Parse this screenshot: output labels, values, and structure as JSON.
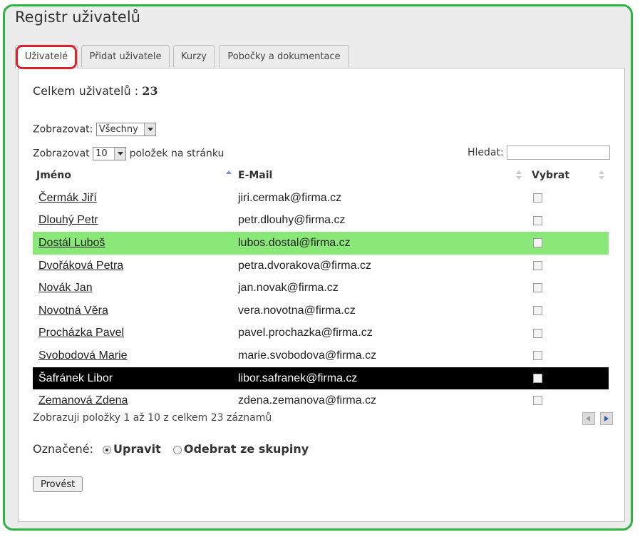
{
  "page": {
    "title": "Registr uživatelů"
  },
  "tabs": [
    {
      "label": "Uživatelé",
      "active": true
    },
    {
      "label": "Přidat uživatele"
    },
    {
      "label": "Kurzy"
    },
    {
      "label": "Pobočky a dokumentace"
    }
  ],
  "summary": {
    "label": "Celkem uživatelů :",
    "count": "23"
  },
  "filter": {
    "label": "Zobrazovat:",
    "selected": "Všechny"
  },
  "perpage": {
    "prefix": "Zobrazovat",
    "selected": "10",
    "suffix": "položek na stránku"
  },
  "search": {
    "label": "Hledat:",
    "value": ""
  },
  "table": {
    "headers": {
      "name": "Jméno",
      "email": "E-Mail",
      "select": "Vybrat"
    },
    "rows": [
      {
        "name": "Čermák Jiří",
        "email": "jiri.cermak@firma.cz"
      },
      {
        "name": "Dlouhý Petr",
        "email": "petr.dlouhy@firma.cz"
      },
      {
        "name": "Dostál Luboš",
        "email": "lubos.dostal@firma.cz",
        "highlight": "green"
      },
      {
        "name": "Dvořáková Petra",
        "email": "petra.dvorakova@firma.cz"
      },
      {
        "name": "Novák Jan",
        "email": "jan.novak@firma.cz"
      },
      {
        "name": "Novotná Věra",
        "email": "vera.novotna@firma.cz"
      },
      {
        "name": "Procházka Pavel",
        "email": "pavel.prochazka@firma.cz"
      },
      {
        "name": "Svobodová Marie",
        "email": "marie.svobodova@firma.cz"
      },
      {
        "name": "Šafránek Libor",
        "email": "libor.safranek@firma.cz",
        "highlight": "black"
      },
      {
        "name": "Zemanová Zdena",
        "email": "zdena.zemanova@firma.cz"
      }
    ]
  },
  "pagination": {
    "info": "Zobrazuji položky 1 až 10 z celkem 23 záznamů"
  },
  "actions": {
    "label": "Označené:",
    "options": [
      "Upravit",
      "Odebrat ze skupiny"
    ],
    "selected": "Upravit",
    "submit_label": "Provést"
  },
  "colors": {
    "frame_border": "#2db340",
    "tab_highlight": "#e0202a",
    "row_green": "#8ae878",
    "row_black": "#000000"
  }
}
